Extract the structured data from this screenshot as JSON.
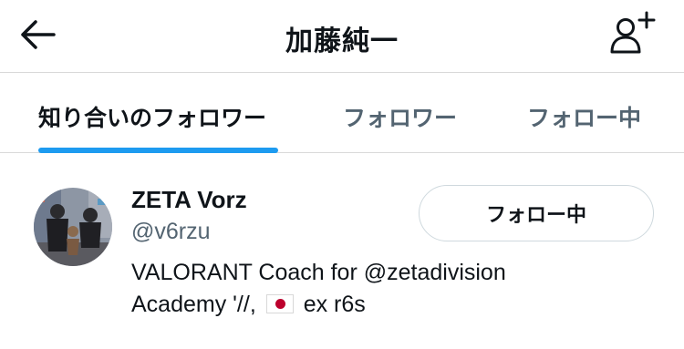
{
  "header": {
    "title": "加藤純一",
    "back_icon": "arrow-left-icon",
    "add_user_icon": "person-plus-icon"
  },
  "tabs": [
    {
      "label": "知り合いのフォロワー",
      "active": true
    },
    {
      "label": "フォロワー",
      "active": false
    },
    {
      "label": "フォロー中",
      "active": false
    }
  ],
  "user": {
    "name": "ZETA Vorz",
    "handle": "@v6rzu",
    "bio_line1": "VALORANT Coach for @zetadivision",
    "bio_line2_prefix": "Academy '//,",
    "bio_line2_suffix": "ex r6s",
    "follow_button_label": "フォロー中"
  },
  "colors": {
    "accent": "#1d9bf0",
    "text_primary": "#0f1419",
    "text_secondary": "#536471",
    "divider": "#d9d9d9",
    "flag_red": "#bc002d"
  }
}
